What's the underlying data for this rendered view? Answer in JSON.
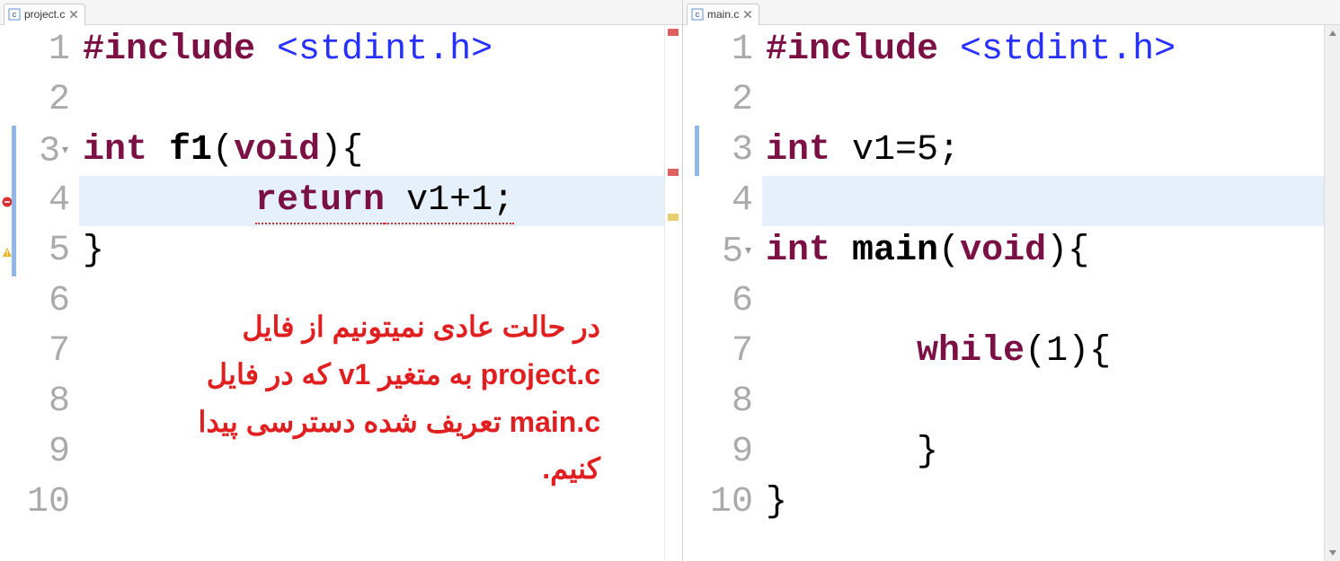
{
  "leftPane": {
    "tabLabel": "project.c",
    "lines": [
      "1",
      "2",
      "3",
      "4",
      "5",
      "6",
      "7",
      "8",
      "9",
      "10"
    ],
    "code": {
      "l1_pre": "#include",
      "l1_inc": "<stdint.h>",
      "l3_type": "int",
      "l3_fn": "f1",
      "l3_paren_open": "(",
      "l3_void": "void",
      "l3_paren_close": ")",
      "l3_brace": "{",
      "l4_indent": "        ",
      "l4_return": "return",
      "l4_expr": " v1+1;",
      "l5_close": "}"
    },
    "foldAt": [
      3
    ],
    "markers": {
      "errorAt": 4,
      "warnAt": 5,
      "changeBarFrom": 3,
      "changeBarTo": 5
    },
    "annotation": "در حالت عادی نمیتونیم از فایل project.c به متغیر v1 که در فایل main.c تعریف شده  دسترسی پیدا کنیم."
  },
  "rightPane": {
    "tabLabel": "main.c",
    "lines": [
      "1",
      "2",
      "3",
      "4",
      "5",
      "6",
      "7",
      "8",
      "9",
      "10"
    ],
    "code": {
      "l1_pre": "#include",
      "l1_inc": "<stdint.h>",
      "l3_type": "int",
      "l3_decl": " v1=5;",
      "l5_type": "int",
      "l5_fn": "main",
      "l5_paren_open": "(",
      "l5_void": "void",
      "l5_paren_close": ")",
      "l5_brace": "{",
      "l7_indent": "       ",
      "l7_while": "while",
      "l7_rest": "(1){",
      "l9_indent": "       ",
      "l9_close": "}",
      "l10_close": "}"
    },
    "foldAt": [
      5
    ],
    "markers": {
      "changeBarFrom": 3,
      "changeBarTo": 3
    }
  }
}
